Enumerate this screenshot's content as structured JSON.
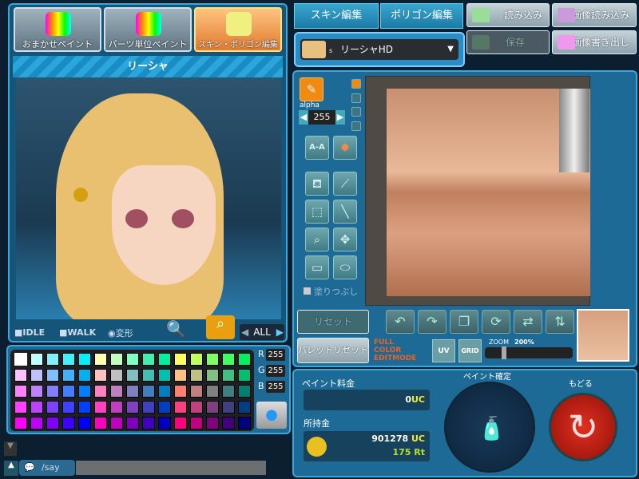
{
  "left_tabs": [
    "おまかせペイント",
    "パーツ単位ペイント",
    "スキン・ポリゴン編集"
  ],
  "character_name": "リーシャ",
  "viewer_controls": {
    "idle": "IDLE",
    "walk": "WALK",
    "transform": "変形",
    "all": "ALL"
  },
  "palette": {
    "rows": [
      [
        "#ffffff",
        "#c0ffff",
        "#80f0ff",
        "#40f0ff",
        "#00f0ff",
        "#ffffb0",
        "#c0ffc0",
        "#80ffc0",
        "#40f0b0",
        "#00f0a0",
        "#ffff60",
        "#c0ff60",
        "#80ff60",
        "#40ff60",
        "#00f060"
      ],
      [
        "#ffc0ff",
        "#c0c0ff",
        "#80c0ff",
        "#40b0ff",
        "#00b0f0",
        "#ffc0c0",
        "#c0c0c0",
        "#80c0c0",
        "#40c0b0",
        "#00c0b0",
        "#ffc080",
        "#c0c080",
        "#80c080",
        "#40c080",
        "#00c070"
      ],
      [
        "#ff80ff",
        "#c080ff",
        "#8080ff",
        "#4080ff",
        "#0080ff",
        "#ff80c0",
        "#c080c0",
        "#8080c0",
        "#4080c0",
        "#0080c0",
        "#ff8070",
        "#c08080",
        "#808080",
        "#408080",
        "#008070"
      ],
      [
        "#ff40ff",
        "#c040ff",
        "#8040ff",
        "#4040ff",
        "#0040ff",
        "#ff40c0",
        "#c040c0",
        "#8040c0",
        "#4040c0",
        "#0040c0",
        "#ff4080",
        "#c04080",
        "#804080",
        "#404080",
        "#004080"
      ],
      [
        "#ff00ff",
        "#c000ff",
        "#8000ff",
        "#4000ff",
        "#0000ff",
        "#ff00c0",
        "#c000c0",
        "#8000c0",
        "#4000c0",
        "#0000c0",
        "#ff0080",
        "#c00080",
        "#800080",
        "#400080",
        "#000080"
      ]
    ],
    "r_label": "R",
    "g_label": "G",
    "b_label": "B",
    "r": "255",
    "g": "255",
    "b": "255"
  },
  "chat": {
    "command": "/say"
  },
  "right_tabs": [
    "スキン編集",
    "ポリゴン編集"
  ],
  "file_buttons": {
    "load": "読み込み",
    "load_image": "画像読み込み",
    "save": "保存",
    "export_image": "画像書き出し"
  },
  "model_select": {
    "badge": "s",
    "value": "リーシャHD"
  },
  "tools": {
    "alpha_label": "alpha",
    "alpha_value": "255",
    "fill_label": "塗りつぶし",
    "aa": "A-A"
  },
  "edit": {
    "reset": "リセット",
    "palette_reset": "パレットリセット",
    "mode_line1": "FULL",
    "mode_line2": "COLOR",
    "mode_line3": "EDITMODE",
    "uv": "UV",
    "grid": "GRID",
    "zoom_label": "ZOOM",
    "zoom_value": "200%",
    "zoom_fraction": 0.2
  },
  "cost": {
    "paint_fee_label": "ペイント料金",
    "paint_fee": "0",
    "uc": "UC",
    "money_label": "所持金",
    "money": "901278",
    "rt_value": "175",
    "rt": "Rt",
    "confirm_label": "ペイント確定",
    "back_label": "もどる"
  },
  "colors": {
    "accent": "#3fa6d6",
    "panel": "#1d6a96",
    "active_tab": "#e07a30"
  }
}
